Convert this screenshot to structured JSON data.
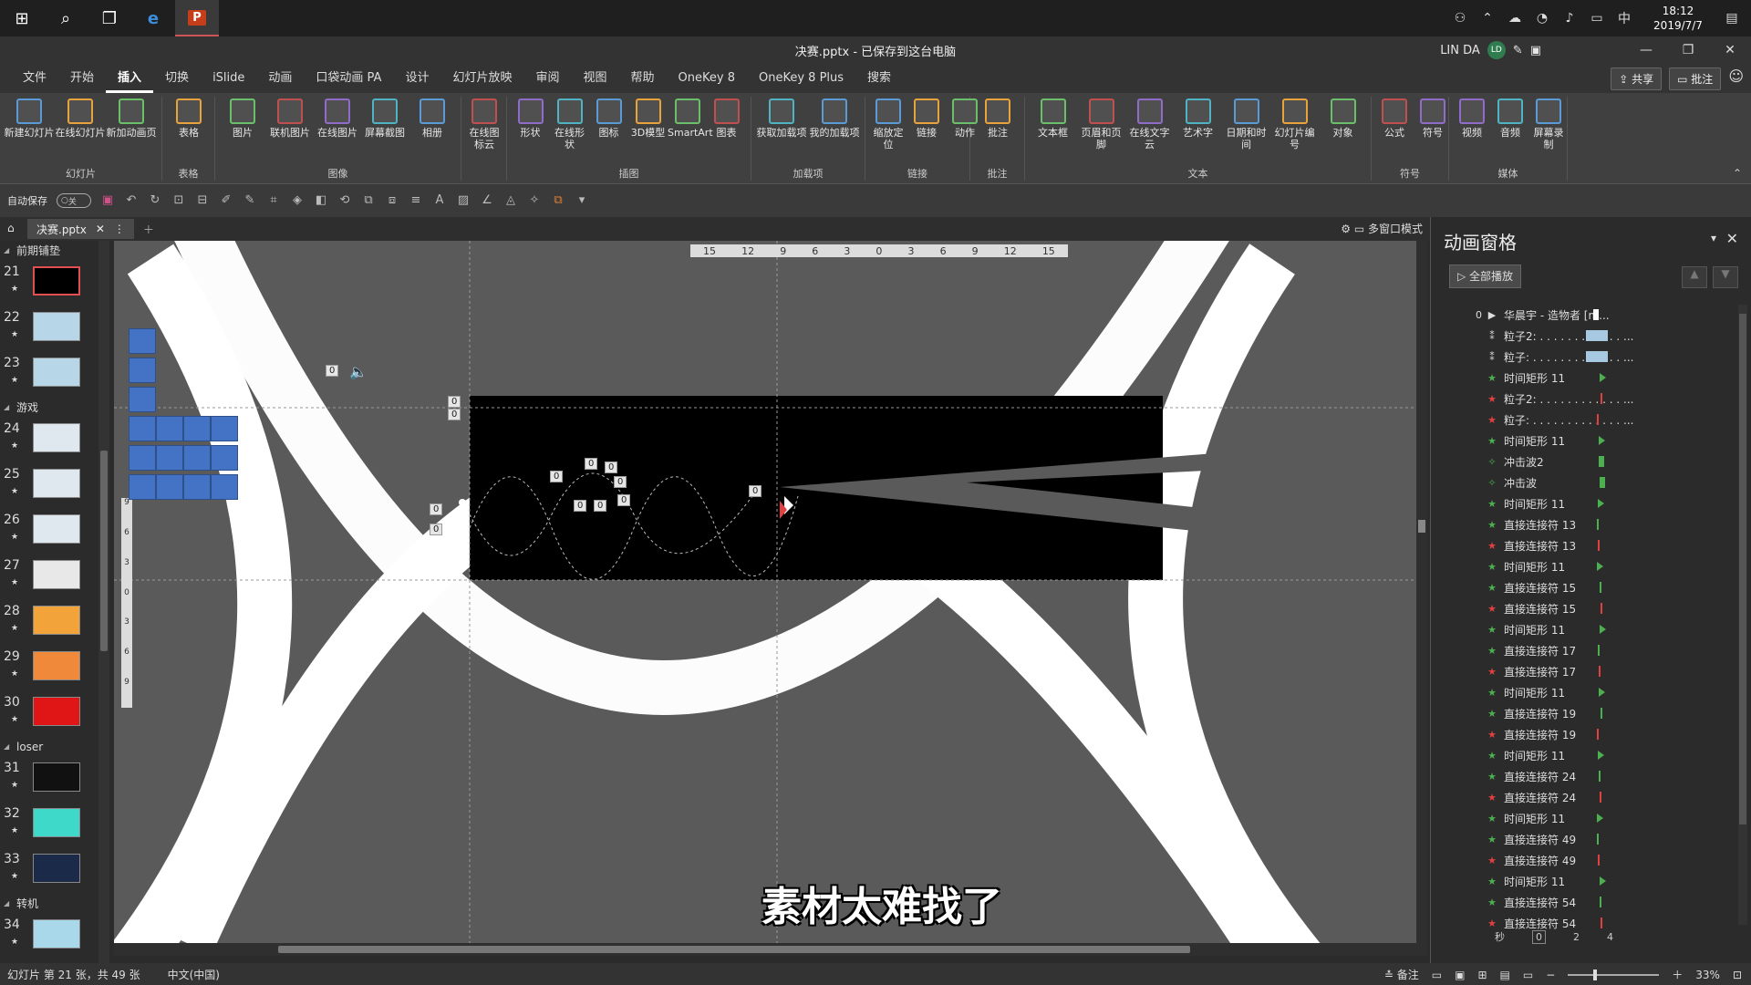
{
  "taskbar": {
    "time": "18:12",
    "date": "2019/7/7",
    "ime": "中"
  },
  "titlebar": {
    "title": "决赛.pptx - 已保存到这台电脑",
    "user": "LIN DA",
    "avatar": "LD"
  },
  "tabs": [
    "文件",
    "开始",
    "插入",
    "切换",
    "iSlide",
    "动画",
    "口袋动画 PA",
    "设计",
    "幻灯片放映",
    "审阅",
    "视图",
    "帮助",
    "OneKey 8",
    "OneKey 8 Plus",
    "搜索"
  ],
  "active_tab": "插入",
  "share_label": "共享",
  "comment_label": "批注",
  "ribbon": {
    "groups": [
      {
        "name": "幻灯片",
        "buttons": [
          "新建幻灯片",
          "在线幻灯片",
          "新加动画页"
        ]
      },
      {
        "name": "表格",
        "buttons": [
          "表格"
        ]
      },
      {
        "name": "图像",
        "buttons": [
          "图片",
          "联机图片",
          "在线图片",
          "屏幕截图",
          "相册"
        ]
      },
      {
        "name": "",
        "buttons": [
          "在线图标云"
        ]
      },
      {
        "name": "插图",
        "buttons": [
          "形状",
          "在线形状",
          "图标",
          "3D模型",
          "SmartArt",
          "图表"
        ]
      },
      {
        "name": "加载项",
        "buttons": [
          "获取加载项",
          "我的加载项"
        ]
      },
      {
        "name": "链接",
        "buttons": [
          "缩放定位",
          "链接",
          "动作"
        ]
      },
      {
        "name": "批注",
        "buttons": [
          "批注"
        ]
      },
      {
        "name": "文本",
        "buttons": [
          "文本框",
          "页眉和页脚",
          "在线文字云",
          "艺术字",
          "日期和时间",
          "幻灯片编号",
          "对象"
        ]
      },
      {
        "name": "符号",
        "buttons": [
          "公式",
          "符号"
        ]
      },
      {
        "name": "媒体",
        "buttons": [
          "视频",
          "音频",
          "屏幕录制"
        ]
      }
    ]
  },
  "qat": {
    "autosave_label": "自动保存",
    "autosave_state": "关"
  },
  "doc_tab": "决赛.pptx",
  "multi_window": "多窗口模式",
  "thumbnails": {
    "sections": [
      {
        "name": "前期铺垫",
        "slides": [
          {
            "num": "21",
            "color": "#000000",
            "selected": true
          },
          {
            "num": "22",
            "color": "#b7d7e8"
          },
          {
            "num": "23",
            "color": "#b7d7e8"
          }
        ]
      },
      {
        "name": "游戏",
        "slides": [
          {
            "num": "24",
            "color": "#dfe8ef"
          },
          {
            "num": "25",
            "color": "#dfe8ef"
          },
          {
            "num": "26",
            "color": "#dfe8ef"
          },
          {
            "num": "27",
            "color": "#e8e8e8"
          },
          {
            "num": "28",
            "color": "#f2a33a"
          },
          {
            "num": "29",
            "color": "#f08a3a"
          },
          {
            "num": "30",
            "color": "#e01515"
          }
        ]
      },
      {
        "name": "loser",
        "slides": [
          {
            "num": "31",
            "color": "#111111"
          },
          {
            "num": "32",
            "color": "#3ed9c8"
          },
          {
            "num": "33",
            "color": "#1b2a48"
          }
        ]
      },
      {
        "name": "转机",
        "slides": [
          {
            "num": "34",
            "color": "#a8d8ea"
          }
        ]
      }
    ]
  },
  "ruler_top": [
    "15",
    "12",
    "9",
    "6",
    "3",
    "0",
    "3",
    "6",
    "9",
    "12",
    "15"
  ],
  "ruler_left": [
    "9",
    "6",
    "3",
    "0",
    "3",
    "6",
    "9"
  ],
  "subtitle": "素材太难找了",
  "anim_pane": {
    "title": "动画窗格",
    "play_all": "全部播放",
    "head_index": "0",
    "items": [
      {
        "lead": "",
        "icon": "▶",
        "label": "华晨宇 - 造物者 [m...",
        "bar": "#ffffff",
        "kind": "media"
      },
      {
        "lead": "",
        "icon": "⁑",
        "label": "粒子2: . . . . . . . . . . . . ...",
        "bar": "#a6c8e0",
        "kind": "path"
      },
      {
        "lead": "",
        "icon": "⁑",
        "label": "粒子: . . . . . . . . . . . . . ...",
        "bar": "#a6c8e0",
        "kind": "path"
      },
      {
        "lead": "",
        "icon": "★",
        "label": "时间矩形 11",
        "bar": "#4caf50",
        "kind": "enter"
      },
      {
        "lead": "",
        "icon": "★",
        "label": "粒子2: . . . . . . . . . . . . ...",
        "bar": "#e04040",
        "kind": "exit"
      },
      {
        "lead": "",
        "icon": "★",
        "label": "粒子: . . . . . . . . . . . . . ...",
        "bar": "#e04040",
        "kind": "exit"
      },
      {
        "lead": "",
        "icon": "★",
        "label": "时间矩形 11",
        "bar": "#4caf50",
        "kind": "enter"
      },
      {
        "lead": "",
        "icon": "✧",
        "label": "冲击波2",
        "bar": "#4caf50",
        "kind": "emph"
      },
      {
        "lead": "",
        "icon": "✧",
        "label": "冲击波",
        "bar": "#4caf50",
        "kind": "emph"
      },
      {
        "lead": "",
        "icon": "★",
        "label": "时间矩形 11",
        "bar": "#4caf50",
        "kind": "enter"
      },
      {
        "lead": "",
        "icon": "★",
        "label": "直接连接符 13",
        "bar": "#4caf50",
        "kind": "enter"
      },
      {
        "lead": "",
        "icon": "★",
        "label": "直接连接符 13",
        "bar": "#e04040",
        "kind": "exit"
      },
      {
        "lead": "",
        "icon": "★",
        "label": "时间矩形 11",
        "bar": "#4caf50",
        "kind": "enter"
      },
      {
        "lead": "",
        "icon": "★",
        "label": "直接连接符 15",
        "bar": "#4caf50",
        "kind": "enter"
      },
      {
        "lead": "",
        "icon": "★",
        "label": "直接连接符 15",
        "bar": "#e04040",
        "kind": "exit"
      },
      {
        "lead": "",
        "icon": "★",
        "label": "时间矩形 11",
        "bar": "#4caf50",
        "kind": "enter"
      },
      {
        "lead": "",
        "icon": "★",
        "label": "直接连接符 17",
        "bar": "#4caf50",
        "kind": "enter"
      },
      {
        "lead": "",
        "icon": "★",
        "label": "直接连接符 17",
        "bar": "#e04040",
        "kind": "exit"
      },
      {
        "lead": "",
        "icon": "★",
        "label": "时间矩形 11",
        "bar": "#4caf50",
        "kind": "enter"
      },
      {
        "lead": "",
        "icon": "★",
        "label": "直接连接符 19",
        "bar": "#4caf50",
        "kind": "enter"
      },
      {
        "lead": "",
        "icon": "★",
        "label": "直接连接符 19",
        "bar": "#e04040",
        "kind": "exit"
      },
      {
        "lead": "",
        "icon": "★",
        "label": "时间矩形 11",
        "bar": "#4caf50",
        "kind": "enter"
      },
      {
        "lead": "",
        "icon": "★",
        "label": "直接连接符 24",
        "bar": "#4caf50",
        "kind": "enter"
      },
      {
        "lead": "",
        "icon": "★",
        "label": "直接连接符 24",
        "bar": "#e04040",
        "kind": "exit"
      },
      {
        "lead": "",
        "icon": "★",
        "label": "时间矩形 11",
        "bar": "#4caf50",
        "kind": "enter"
      },
      {
        "lead": "",
        "icon": "★",
        "label": "直接连接符 49",
        "bar": "#4caf50",
        "kind": "enter"
      },
      {
        "lead": "",
        "icon": "★",
        "label": "直接连接符 49",
        "bar": "#e04040",
        "kind": "exit"
      },
      {
        "lead": "",
        "icon": "★",
        "label": "时间矩形 11",
        "bar": "#4caf50",
        "kind": "enter"
      },
      {
        "lead": "",
        "icon": "★",
        "label": "直接连接符 54",
        "bar": "#4caf50",
        "kind": "enter"
      },
      {
        "lead": "",
        "icon": "★",
        "label": "直接连接符 54",
        "bar": "#e04040",
        "kind": "exit"
      }
    ],
    "timeline": {
      "unit": "秒",
      "ticks": [
        "0",
        "2",
        "4"
      ]
    }
  },
  "status": {
    "slide_info": "幻灯片 第 21 张，共 49 张",
    "language": "中文(中国)",
    "notes": "备注",
    "zoom": "33%"
  }
}
